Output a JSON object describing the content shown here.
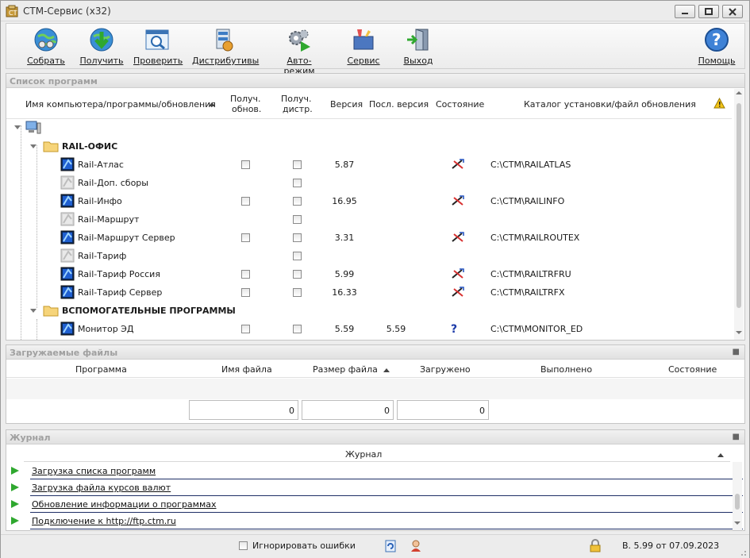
{
  "window": {
    "title": "СТМ-Сервис (x32)"
  },
  "toolbar": {
    "collect": "Собрать",
    "receive": "Получить",
    "check": "Проверить",
    "distributives": "Дистрибутивы",
    "automode": "Авто-режим",
    "service": "Сервис",
    "exit": "Выход",
    "help": "Помощь"
  },
  "programs": {
    "title": "Список программ",
    "headers": {
      "name": "Имя компьютера/программы/обновления",
      "get_upd_1": "Получ.",
      "get_upd_2": "обнов.",
      "get_dist_1": "Получ.",
      "get_dist_2": "дистр.",
      "version": "Версия",
      "last_version": "Посл. версия",
      "state": "Состояние",
      "catalog": "Каталог установки/файл обновления"
    },
    "groups": [
      {
        "name": "RAIL-ОФИС"
      },
      {
        "name": "ВСПОМОГАТЕЛЬНЫЕ ПРОГРАММЫ"
      }
    ],
    "rows": [
      {
        "name": "Rail-Атлас",
        "version": "5.87",
        "last": "",
        "path": "C:\\CTM\\RAILATLAS"
      },
      {
        "name": "Rail-Доп. сборы",
        "version": "",
        "last": "",
        "path": ""
      },
      {
        "name": "Rail-Инфо",
        "version": "16.95",
        "last": "",
        "path": "C:\\CTM\\RAILINFO"
      },
      {
        "name": "Rail-Маршрут",
        "version": "",
        "last": "",
        "path": ""
      },
      {
        "name": "Rail-Маршрут Сервер",
        "version": "3.31",
        "last": "",
        "path": "C:\\CTM\\RAILROUTEX"
      },
      {
        "name": "Rail-Тариф",
        "version": "",
        "last": "",
        "path": ""
      },
      {
        "name": "Rail-Тариф Россия",
        "version": "5.99",
        "last": "",
        "path": "C:\\CTM\\RAILTRFRU"
      },
      {
        "name": "Rail-Тариф Сервер",
        "version": "16.33",
        "last": "",
        "path": "C:\\CTM\\RAILTRFX"
      },
      {
        "name": "Монитор ЭД",
        "version": "5.59",
        "last": "5.59",
        "path": "C:\\CTM\\MONITOR_ED"
      }
    ]
  },
  "downloads": {
    "title": "Загружаемые файлы",
    "headers": {
      "program": "Программа",
      "filename": "Имя файла",
      "filesize": "Размер файла",
      "loaded": "Загружено",
      "done": "Выполнено",
      "state": "Состояние"
    },
    "totals": [
      "0",
      "0",
      "0"
    ]
  },
  "journal": {
    "title": "Журнал",
    "header": "Журнал",
    "items": [
      "Загрузка списка программ",
      "Загрузка файла курсов валют",
      "Обновление информации о программах",
      "Подключение к http://ftp.ctm.ru"
    ]
  },
  "status": {
    "ignore_errors": "Игнорировать ошибки",
    "version": "В. 5.99 от 07.09.2023"
  }
}
